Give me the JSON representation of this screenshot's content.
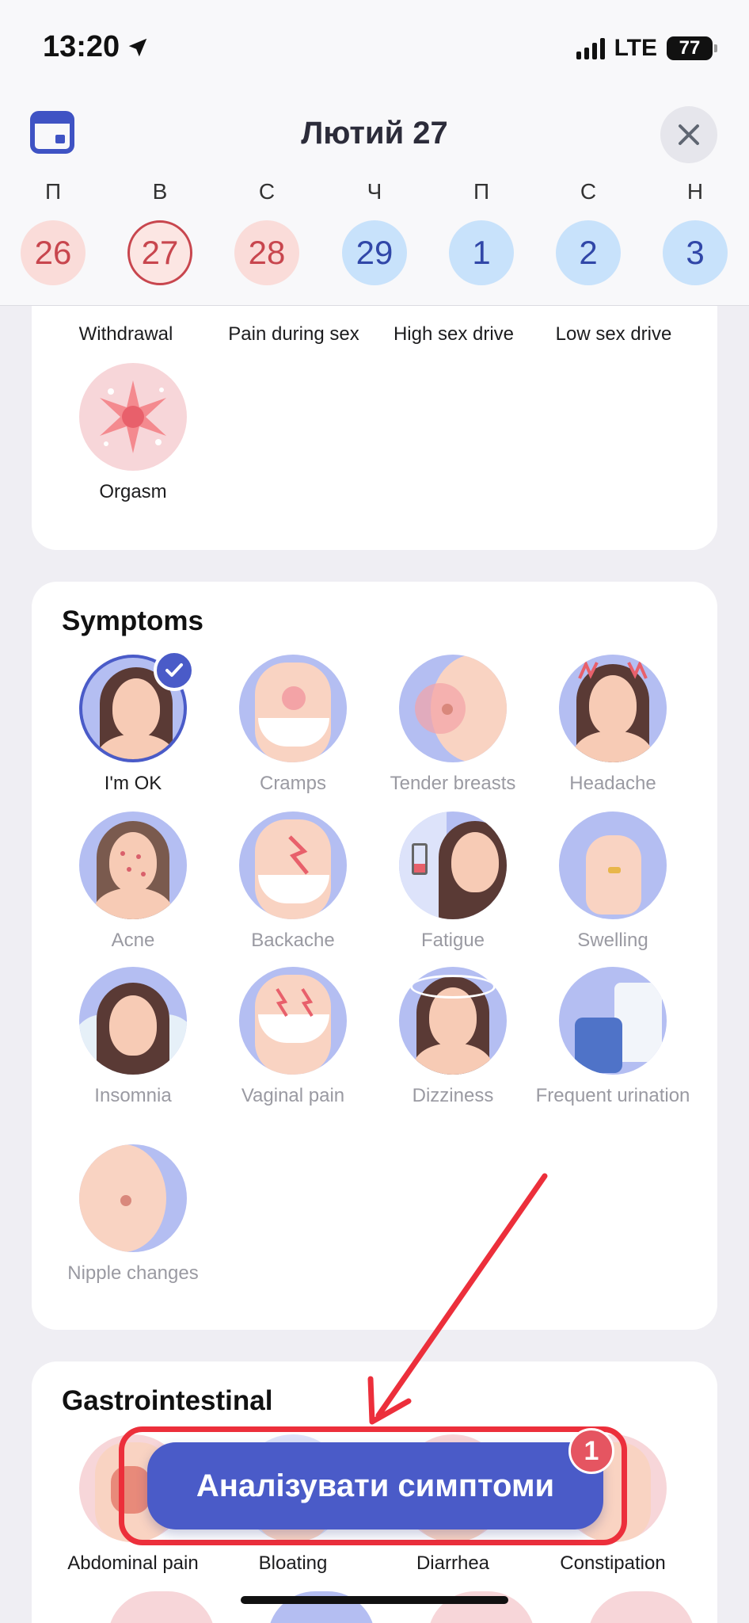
{
  "status_bar": {
    "time": "13:20",
    "network": "LTE",
    "battery": "77"
  },
  "header": {
    "title": "Лютий 27",
    "icons": {
      "calendar": "calendar-icon",
      "close": "close-icon"
    },
    "week": [
      {
        "letter": "П",
        "day": "26",
        "kind": "pink"
      },
      {
        "letter": "В",
        "day": "27",
        "kind": "pink-selected"
      },
      {
        "letter": "С",
        "day": "28",
        "kind": "pink"
      },
      {
        "letter": "Ч",
        "day": "29",
        "kind": "blue"
      },
      {
        "letter": "П",
        "day": "1",
        "kind": "blue"
      },
      {
        "letter": "С",
        "day": "2",
        "kind": "blue"
      },
      {
        "letter": "Н",
        "day": "3",
        "kind": "blue"
      }
    ]
  },
  "sex_card": {
    "items": [
      "Withdrawal",
      "Pain during sex",
      "High sex drive",
      "Low sex drive",
      "Orgasm"
    ]
  },
  "symptoms": {
    "title": "Symptoms",
    "items": [
      "I'm OK",
      "Cramps",
      "Tender breasts",
      "Headache",
      "Acne",
      "Backache",
      "Fatigue",
      "Swelling",
      "Insomnia",
      "Vaginal pain",
      "Dizziness",
      "Frequent urination",
      "Nipple changes"
    ],
    "selected": "I'm OK"
  },
  "gastro": {
    "title": "Gastrointestinal",
    "items": [
      "Abdominal pain",
      "Bloating",
      "Diarrhea",
      "Constipation"
    ]
  },
  "analyze": {
    "label": "Аналізувати симптоми",
    "badge": "1"
  },
  "colors": {
    "accent": "#4A5BC8",
    "annotation": "#EC2F3B",
    "period": "#C8464E",
    "future": "#3147A8"
  }
}
